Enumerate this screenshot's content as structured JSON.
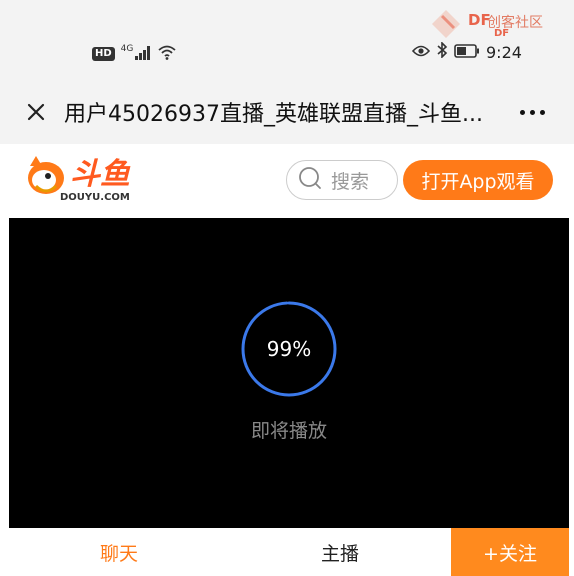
{
  "status_bar": {
    "hd_label": "HD",
    "network_label": "4G",
    "time": "9:24",
    "icons": [
      "signal-icon",
      "wifi-icon",
      "eye-icon",
      "bluetooth-icon",
      "battery-icon"
    ]
  },
  "watermark": {
    "brand": "DF",
    "site": "创客社区",
    "brand_small": "DF"
  },
  "title_bar": {
    "title": "用户45026937直播_英雄联盟直播_斗鱼...",
    "icons": [
      "close-icon",
      "more-icon"
    ]
  },
  "site_header": {
    "logo_domain": "DOUYU.COM",
    "search_label": "搜索",
    "open_app_label": "打开App观看",
    "accent_color": "#ff7a18"
  },
  "player": {
    "progress_percent_text": "99%",
    "progress_value": 0.99,
    "status_text": "即将播放"
  },
  "tabs": {
    "chat_label": "聊天",
    "anchor_label": "主播",
    "follow_label": "+关注"
  }
}
